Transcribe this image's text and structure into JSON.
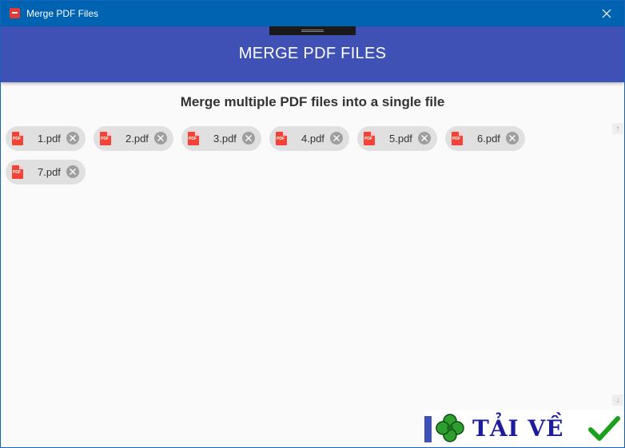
{
  "window": {
    "title": "Merge PDF Files",
    "close_icon": "close-icon"
  },
  "header": {
    "title": "MERGE PDF FILES"
  },
  "main": {
    "subtitle": "Merge multiple PDF files into a single file",
    "files": [
      {
        "name": "1.pdf",
        "icon": "pdf-file-icon"
      },
      {
        "name": "2.pdf",
        "icon": "pdf-file-icon"
      },
      {
        "name": "3.pdf",
        "icon": "pdf-file-icon"
      },
      {
        "name": "4.pdf",
        "icon": "pdf-file-icon"
      },
      {
        "name": "5.pdf",
        "icon": "pdf-file-icon"
      },
      {
        "name": "6.pdf",
        "icon": "pdf-file-icon"
      },
      {
        "name": "7.pdf",
        "icon": "pdf-file-icon"
      }
    ]
  },
  "watermark": {
    "text": "TẢI VỀ"
  },
  "colors": {
    "titlebar": "#0063b1",
    "header": "#3f51b5",
    "pdf_icon": "#f44336",
    "chip": "#e0e0e0"
  }
}
